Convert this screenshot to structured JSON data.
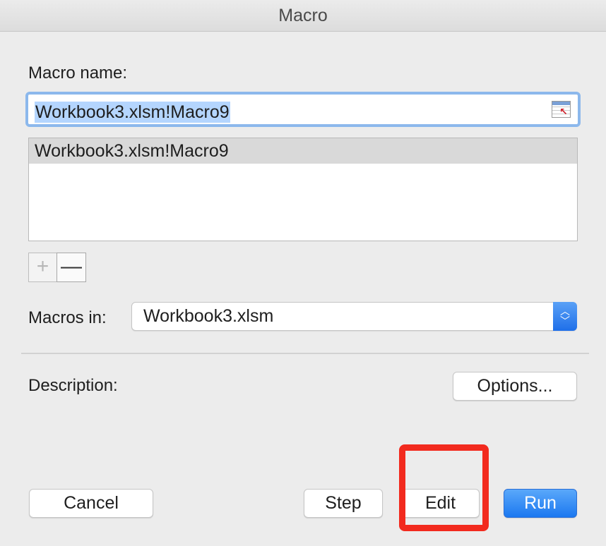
{
  "window": {
    "title": "Macro"
  },
  "macro_name": {
    "label": "Macro name:",
    "value": "Workbook3.xlsm!Macro9",
    "picker_icon": "range-picker-icon"
  },
  "macro_list": {
    "items": [
      "Workbook3.xlsm!Macro9"
    ],
    "selected_index": 0
  },
  "list_controls": {
    "add_label": "+",
    "remove_label": "—"
  },
  "macros_in": {
    "label": "Macros in:",
    "value": "Workbook3.xlsm"
  },
  "description": {
    "label": "Description:"
  },
  "buttons": {
    "options": "Options...",
    "cancel": "Cancel",
    "step": "Step",
    "edit": "Edit",
    "run": "Run"
  },
  "annotation": {
    "highlight_color": "#f22a1e",
    "target": "Edit"
  },
  "colors": {
    "accent": "#1b78f0",
    "selection": "#b4d5fe"
  }
}
